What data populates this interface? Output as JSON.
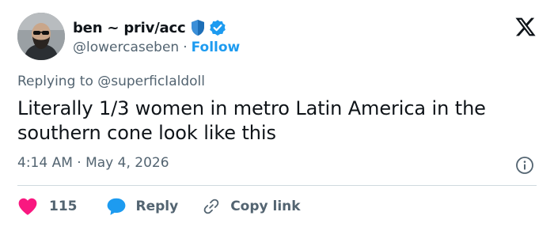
{
  "author": {
    "display_name": "ben ~ priv/acc",
    "handle": "@lowercaseben",
    "separator": "·",
    "follow_label": "Follow"
  },
  "reply_context": {
    "prefix": "Replying to ",
    "target": "@superficIaldoll"
  },
  "tweet": {
    "text": "Literally 1/3 women in metro Latin America in the southern cone look like this",
    "timestamp": "4:14 AM · May 4, 2026"
  },
  "actions": {
    "like_count": "115",
    "reply_label": "Reply",
    "copy_link_label": "Copy link"
  },
  "icons": {
    "avatar": "avatar-photo",
    "badge": "shield-icon",
    "verified": "verified-check-icon",
    "platform": "x-logo-icon",
    "info": "info-icon",
    "like": "heart-icon",
    "reply": "speech-bubble-icon",
    "copy": "link-icon"
  },
  "colors": {
    "accent": "#1d9bf0",
    "like": "#f91880",
    "secondary_text": "#536471",
    "primary_text": "#0f1419",
    "divider": "#cfd9de"
  }
}
